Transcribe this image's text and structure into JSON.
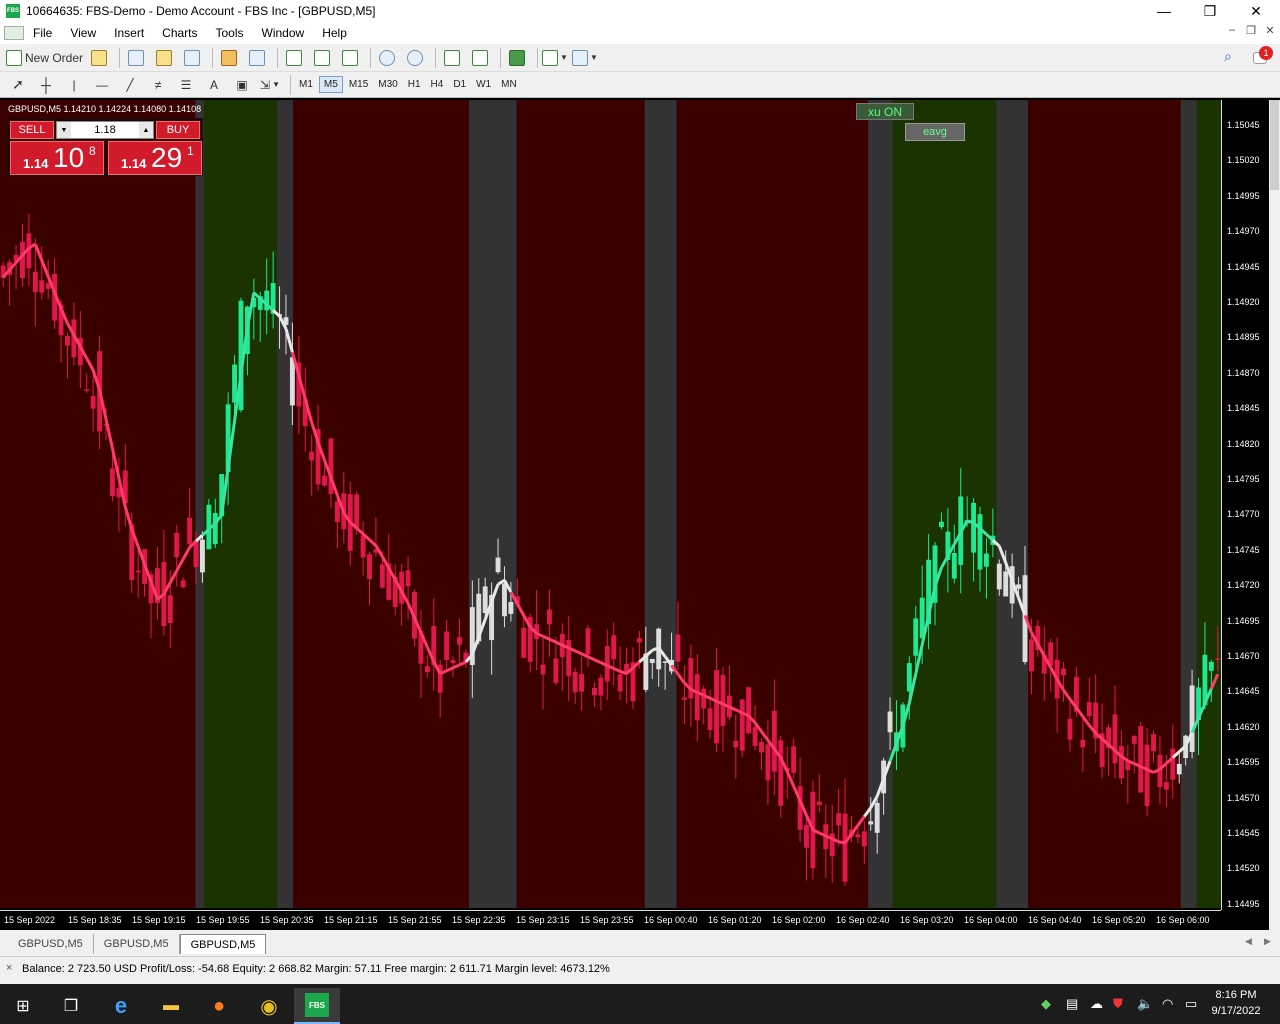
{
  "window": {
    "title": "10664635: FBS-Demo - Demo Account - FBS Inc - [GBPUSD,M5]",
    "logo_text": "FBS",
    "minimize": "—",
    "maximize": "❐",
    "close": "✕"
  },
  "menu": {
    "items": [
      "File",
      "View",
      "Insert",
      "Charts",
      "Tools",
      "Window",
      "Help"
    ],
    "mdi_minimize": "–",
    "mdi_restore": "❐",
    "mdi_close": "✕"
  },
  "toolbar": {
    "new_order_label": "New Order",
    "timeframes": [
      "M1",
      "M5",
      "M15",
      "M30",
      "H1",
      "H4",
      "D1",
      "W1",
      "MN"
    ],
    "active_timeframe": "M5",
    "notification_badge": "1"
  },
  "chart": {
    "header": "GBPUSD,M5  1.14210 1.14224 1.14080 1.14108",
    "sell_label": "SELL",
    "buy_label": "BUY",
    "lot_value": "1.18",
    "sell_price_prefix": "1.14",
    "sell_price_big": "10",
    "sell_price_sup": "8",
    "buy_price_prefix": "1.14",
    "buy_price_big": "29",
    "buy_price_sup": "1",
    "xu_button": "xu ON",
    "eavg_button": "eavg",
    "colors": {
      "bear_zone": "#3a0000",
      "bull_zone": "#1a3300",
      "neutral_zone": "#333333",
      "bear_candle": "#e0184a",
      "bull_candle": "#1ee890",
      "neutral_candle": "#dddddd"
    },
    "price_labels": [
      "1.15045",
      "1.15020",
      "1.14995",
      "1.14970",
      "1.14945",
      "1.14920",
      "1.14895",
      "1.14870",
      "1.14845",
      "1.14820",
      "1.14795",
      "1.14770",
      "1.14745",
      "1.14720",
      "1.14695",
      "1.14670",
      "1.14645",
      "1.14620",
      "1.14595",
      "1.14570",
      "1.14545",
      "1.14520",
      "1.14495"
    ],
    "time_labels": [
      "15 Sep 2022",
      "15 Sep 18:35",
      "15 Sep 19:15",
      "15 Sep 19:55",
      "15 Sep 20:35",
      "15 Sep 21:15",
      "15 Sep 21:55",
      "15 Sep 22:35",
      "15 Sep 23:15",
      "15 Sep 23:55",
      "16 Sep 00:40",
      "16 Sep 01:20",
      "16 Sep 02:00",
      "16 Sep 02:40",
      "16 Sep 03:20",
      "16 Sep 04:00",
      "16 Sep 04:40",
      "16 Sep 05:20",
      "16 Sep 06:00"
    ]
  },
  "chart_data": {
    "type": "candlestick",
    "xlabels": [
      "15 Sep 2022",
      "15 Sep 18:35",
      "15 Sep 19:15",
      "15 Sep 19:55",
      "15 Sep 20:35",
      "15 Sep 21:15",
      "15 Sep 21:55",
      "15 Sep 22:35",
      "15 Sep 23:15",
      "15 Sep 23:55",
      "16 Sep 00:40",
      "16 Sep 01:20",
      "16 Sep 02:00",
      "16 Sep 02:40",
      "16 Sep 03:20",
      "16 Sep 04:00",
      "16 Sep 04:40",
      "16 Sep 05:20",
      "16 Sep 06:00"
    ],
    "ylim": [
      1.14485,
      1.15055
    ],
    "close_path": [
      1.1493,
      1.14955,
      1.149,
      1.1486,
      1.1476,
      1.147,
      1.1474,
      1.1476,
      1.1492,
      1.149,
      1.1482,
      1.1476,
      1.1474,
      1.147,
      1.1465,
      1.1466,
      1.1472,
      1.1468,
      1.1467,
      1.1466,
      1.1465,
      1.1467,
      1.1464,
      1.1463,
      1.1462,
      1.1459,
      1.1454,
      1.1453,
      1.1456,
      1.1462,
      1.1472,
      1.1476,
      1.1474,
      1.1468,
      1.1464,
      1.1461,
      1.1459,
      1.1458,
      1.146,
      1.1465
    ],
    "zones": [
      {
        "kind": "bear",
        "from": 0.0,
        "to": 0.16
      },
      {
        "kind": "neutral",
        "from": 0.16,
        "to": 0.167
      },
      {
        "kind": "bull",
        "from": 0.167,
        "to": 0.227
      },
      {
        "kind": "neutral",
        "from": 0.227,
        "to": 0.24
      },
      {
        "kind": "bear",
        "from": 0.24,
        "to": 0.384
      },
      {
        "kind": "neutral",
        "from": 0.384,
        "to": 0.423
      },
      {
        "kind": "bear",
        "from": 0.423,
        "to": 0.528
      },
      {
        "kind": "neutral",
        "from": 0.528,
        "to": 0.554
      },
      {
        "kind": "bear",
        "from": 0.554,
        "to": 0.711
      },
      {
        "kind": "neutral",
        "from": 0.711,
        "to": 0.731
      },
      {
        "kind": "bull",
        "from": 0.731,
        "to": 0.816
      },
      {
        "kind": "neutral",
        "from": 0.816,
        "to": 0.842
      },
      {
        "kind": "bear",
        "from": 0.842,
        "to": 0.967
      },
      {
        "kind": "neutral",
        "from": 0.967,
        "to": 0.98
      },
      {
        "kind": "bull",
        "from": 0.98,
        "to": 1.0
      }
    ]
  },
  "tabs": [
    "GBPUSD,M5",
    "GBPUSD,M5",
    "GBPUSD,M5"
  ],
  "active_tab": 2,
  "status": {
    "text": "Balance: 2 723.50 USD  Profit/Loss: -54.68  Equity: 2 668.82  Margin: 57.11  Free margin: 2 611.71  Margin level: 4673.12%"
  },
  "taskbar": {
    "time": "8:16 PM",
    "date": "9/17/2022",
    "mt_label": "FBS"
  }
}
